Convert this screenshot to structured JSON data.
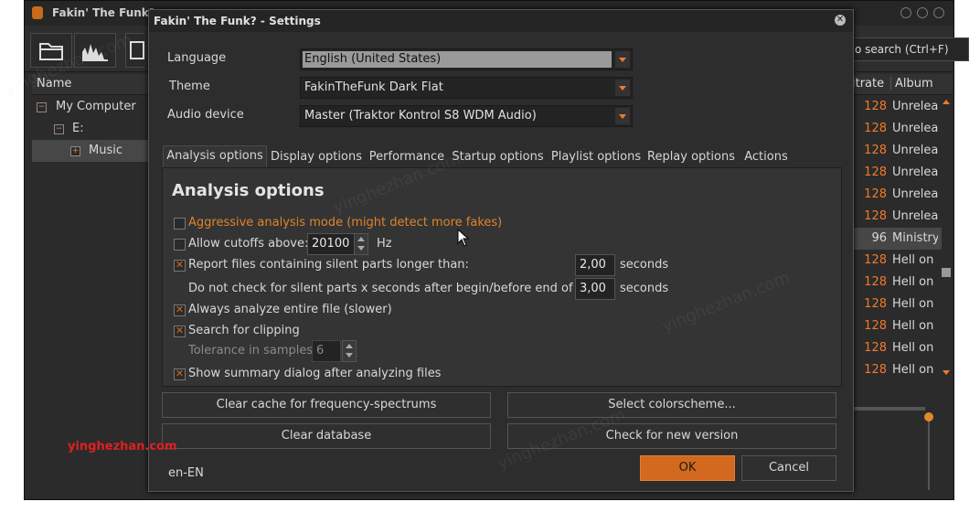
{
  "main_window": {
    "title": "Fakin' The Funk?",
    "search_placeholder": "o search (Ctrl+F)",
    "tree_header": "Name",
    "tree": [
      {
        "label": "My Computer",
        "expander": "−"
      },
      {
        "label": "E:",
        "expander": "−"
      },
      {
        "label": "Music",
        "expander": "+"
      }
    ],
    "grid_headers": {
      "bitrate": "itrate",
      "album": "Album"
    },
    "grid_rows": [
      {
        "bitrate": "128",
        "album": "Unreleased"
      },
      {
        "bitrate": "128",
        "album": "Unreleased"
      },
      {
        "bitrate": "128",
        "album": "Unreleased"
      },
      {
        "bitrate": "128",
        "album": "Unreleased"
      },
      {
        "bitrate": "128",
        "album": "Unreleased"
      },
      {
        "bitrate": "128",
        "album": "Unreleased"
      },
      {
        "bitrate": "96",
        "album": "Ministry"
      },
      {
        "bitrate": "128",
        "album": "Hell on"
      },
      {
        "bitrate": "128",
        "album": "Hell on"
      },
      {
        "bitrate": "128",
        "album": "Hell on"
      },
      {
        "bitrate": "128",
        "album": "Hell on"
      },
      {
        "bitrate": "128",
        "album": "Hell on"
      },
      {
        "bitrate": "128",
        "album": "Hell on"
      }
    ]
  },
  "dialog": {
    "title": "Fakin' The Funk? - Settings",
    "language_label": "Language",
    "language_value": "English (United States)",
    "theme_label": "Theme",
    "theme_value": "FakinTheFunk Dark Flat",
    "audio_label": "Audio device",
    "audio_value": "Master (Traktor Kontrol S8 WDM Audio)",
    "tabs": [
      "Analysis options",
      "Display options",
      "Performance",
      "Startup options",
      "Playlist options",
      "Replay options",
      "Actions"
    ],
    "panel_heading": "Analysis options",
    "options": {
      "aggressive": "Aggressive analysis mode (might detect more fakes)",
      "cutoffs": "Allow cutoffs above:",
      "cutoffs_value": "20100",
      "cutoffs_unit": "Hz",
      "silent": "Report files containing silent parts longer than:",
      "silent_value": "2,00",
      "silent_unit": "seconds",
      "nocheck": "Do not check for silent parts x seconds after begin/before end of song",
      "nocheck_value": "3,00",
      "nocheck_unit": "seconds",
      "entire": "Always analyze entire file (slower)",
      "clipping": "Search for clipping",
      "tolerance": "Tolerance in samples:",
      "tolerance_value": "6",
      "summary": "Show summary dialog after analyzing files"
    },
    "buttons": {
      "clear_cache": "Clear cache for frequency-spectrums",
      "colorscheme": "Select colorscheme...",
      "clear_db": "Clear database",
      "check_version": "Check for new version",
      "ok": "OK",
      "cancel": "Cancel"
    },
    "locale": "en-EN"
  },
  "watermark": "yinghezhan.com",
  "colors": {
    "accent": "#d2691e",
    "orange_text": "#f07a2a",
    "background": "#2d2d2d"
  }
}
